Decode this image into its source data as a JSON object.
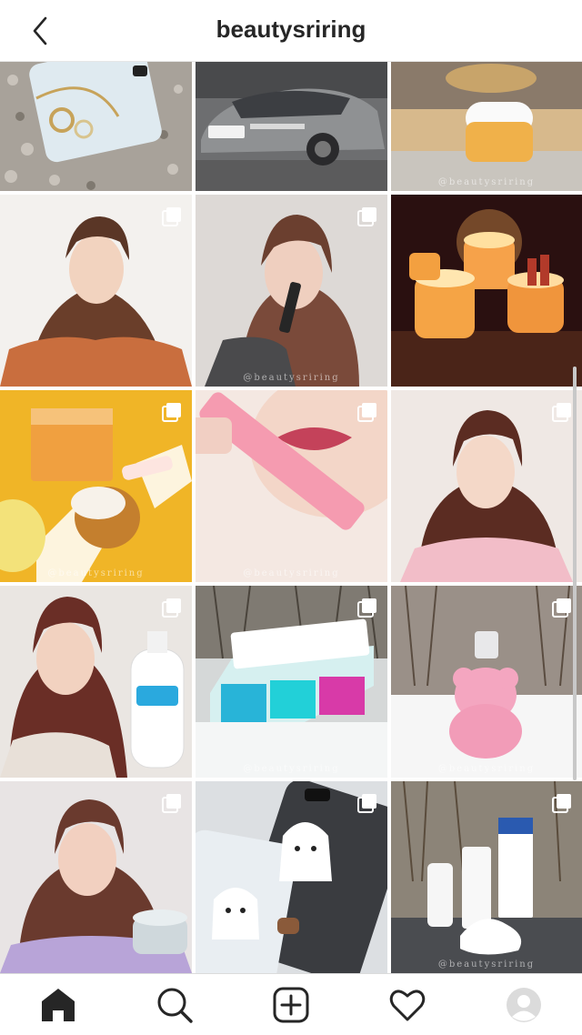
{
  "header": {
    "title": "beautysriring",
    "back_icon": "chevron-left-icon"
  },
  "grid": {
    "watermark": "@beautysriring",
    "posts": [
      {
        "subject": "phone-and-bracelet-on-gravel",
        "multi": false,
        "watermark": false
      },
      {
        "subject": "grey-sedan-car",
        "multi": false,
        "watermark": false
      },
      {
        "subject": "cream-jar-on-shelf",
        "multi": false,
        "watermark": true
      },
      {
        "subject": "selfie-orange-sweater",
        "multi": true,
        "watermark": false
      },
      {
        "subject": "lip-product-selfie",
        "multi": true,
        "watermark": true
      },
      {
        "subject": "candles-on-table",
        "multi": false,
        "watermark": false
      },
      {
        "subject": "laneige-products-yellow",
        "multi": true,
        "watermark": true
      },
      {
        "subject": "lip-gloss-swatch",
        "multi": true,
        "watermark": true
      },
      {
        "subject": "selfie-pink-hoodie",
        "multi": true,
        "watermark": false
      },
      {
        "subject": "selfie-body-lotion",
        "multi": true,
        "watermark": false
      },
      {
        "subject": "skincare-box-in-snow",
        "multi": true,
        "watermark": true
      },
      {
        "subject": "bear-perfume-in-snow",
        "multi": true,
        "watermark": true
      },
      {
        "subject": "selfie-cream-jar",
        "multi": true,
        "watermark": false
      },
      {
        "subject": "ghost-phone-cases",
        "multi": true,
        "watermark": false
      },
      {
        "subject": "cleanser-bottles-on-rock",
        "multi": true,
        "watermark": true
      }
    ]
  },
  "tabbar": {
    "items": [
      {
        "name": "home",
        "icon": "home-icon",
        "active": true
      },
      {
        "name": "search",
        "icon": "search-icon",
        "active": false
      },
      {
        "name": "new-post",
        "icon": "add-square-icon",
        "active": false
      },
      {
        "name": "activity",
        "icon": "heart-icon",
        "active": false
      },
      {
        "name": "profile",
        "icon": "avatar-icon",
        "active": false
      }
    ]
  },
  "colors": {
    "accent": "#262626",
    "divider": "#dbdbdb",
    "background": "#ffffff"
  }
}
